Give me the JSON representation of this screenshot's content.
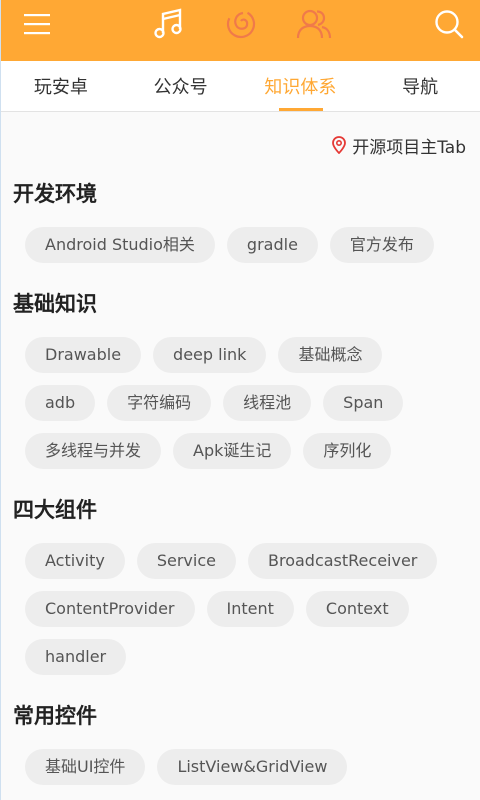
{
  "header": {
    "icons": [
      "menu-icon",
      "music-note-icon",
      "netease-music-icon",
      "friends-icon",
      "search-icon"
    ]
  },
  "tabs": [
    {
      "label": "玩安卓",
      "active": false
    },
    {
      "label": "公众号",
      "active": false
    },
    {
      "label": "知识体系",
      "active": true
    },
    {
      "label": "导航",
      "active": false
    }
  ],
  "open_source_link": {
    "label": "开源项目主Tab",
    "icon": "location-pin-icon"
  },
  "sections": [
    {
      "title": "开发环境",
      "chips": [
        "Android Studio相关",
        "gradle",
        "官方发布"
      ]
    },
    {
      "title": "基础知识",
      "chips": [
        "Drawable",
        "deep link",
        "基础概念",
        "adb",
        "字符编码",
        "线程池",
        "Span",
        "多线程与并发",
        "Apk诞生记",
        "序列化"
      ]
    },
    {
      "title": "四大组件",
      "chips": [
        "Activity",
        "Service",
        "BroadcastReceiver",
        "ContentProvider",
        "Intent",
        "Context",
        "handler"
      ]
    },
    {
      "title": "常用控件",
      "chips": [
        "基础UI控件",
        "ListView&GridView"
      ]
    }
  ],
  "colors": {
    "accent": "#ffa834",
    "chip_bg": "#ededed",
    "pin": "#e53935"
  }
}
